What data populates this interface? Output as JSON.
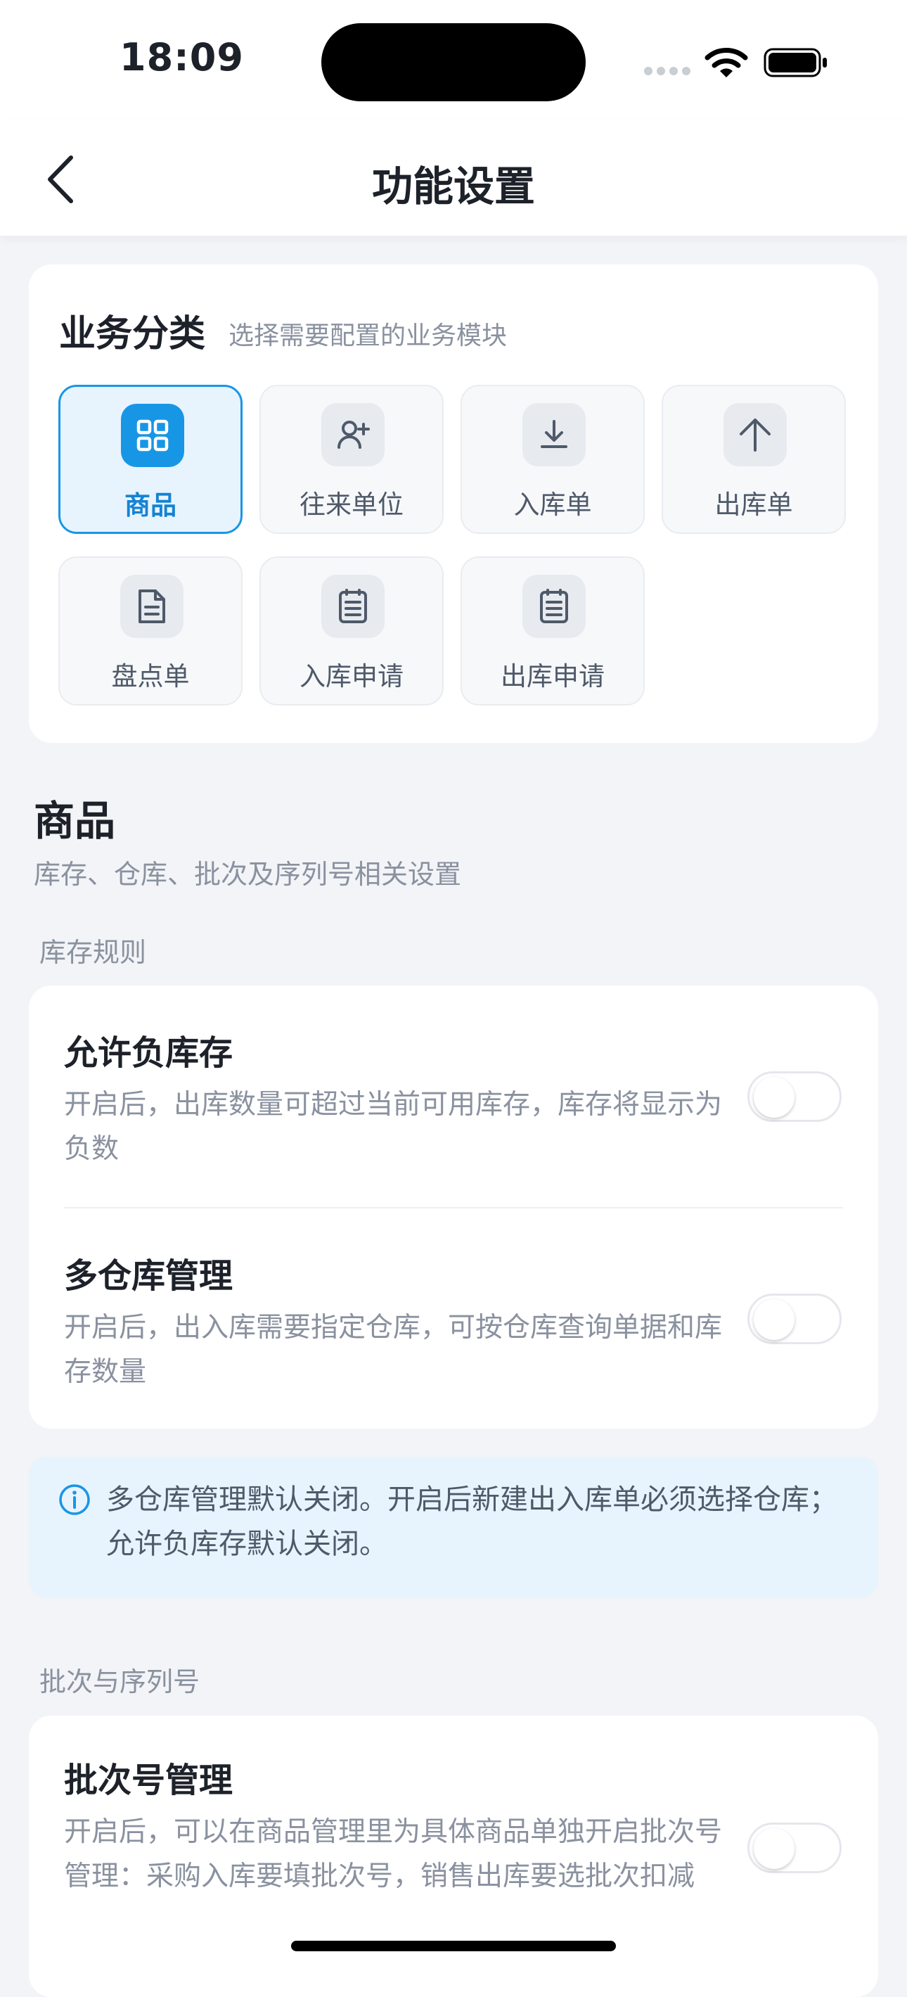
{
  "status_bar": {
    "time": "18:09"
  },
  "nav": {
    "title": "功能设置",
    "back_icon": "chevron-left-icon"
  },
  "categories": {
    "title": "业务分类",
    "subtitle": "选择需要配置的业务模块",
    "items": [
      {
        "label": "商品",
        "icon": "grid-icon",
        "selected": true
      },
      {
        "label": "往来单位",
        "icon": "user-add-icon",
        "selected": false
      },
      {
        "label": "入库单",
        "icon": "download-icon",
        "selected": false
      },
      {
        "label": "出库单",
        "icon": "arrow-up-icon",
        "selected": false
      },
      {
        "label": "盘点单",
        "icon": "document-icon",
        "selected": false
      },
      {
        "label": "入库申请",
        "icon": "list-document-icon",
        "selected": false
      },
      {
        "label": "出库申请",
        "icon": "list-document-icon",
        "selected": false
      }
    ]
  },
  "section": {
    "title": "商品",
    "subtitle": "库存、仓库、批次及序列号相关设置"
  },
  "groups": {
    "stock_rules": {
      "label": "库存规则",
      "settings": [
        {
          "title": "允许负库存",
          "desc": "开启后，出库数量可超过当前可用库存，库存将显示为负数",
          "enabled": false
        },
        {
          "title": "多仓库管理",
          "desc": "开启后，出入库需要指定仓库，可按仓库查询单据和库存数量",
          "enabled": false
        }
      ]
    },
    "batch_serial": {
      "label": "批次与序列号",
      "settings": [
        {
          "title": "批次号管理",
          "desc": "开启后，可以在商品管理里为具体商品单独开启批次号管理：采购入库要填批次号，销售出库要选批次扣减",
          "enabled": false
        }
      ]
    }
  },
  "info": {
    "text": "多仓库管理默认关闭。开启后新建出入库单必须选择仓库；允许负库存默认关闭。"
  },
  "colors": {
    "accent": "#1896e6",
    "accent_light": "#e8f4fd",
    "background": "#f2f4f7"
  }
}
